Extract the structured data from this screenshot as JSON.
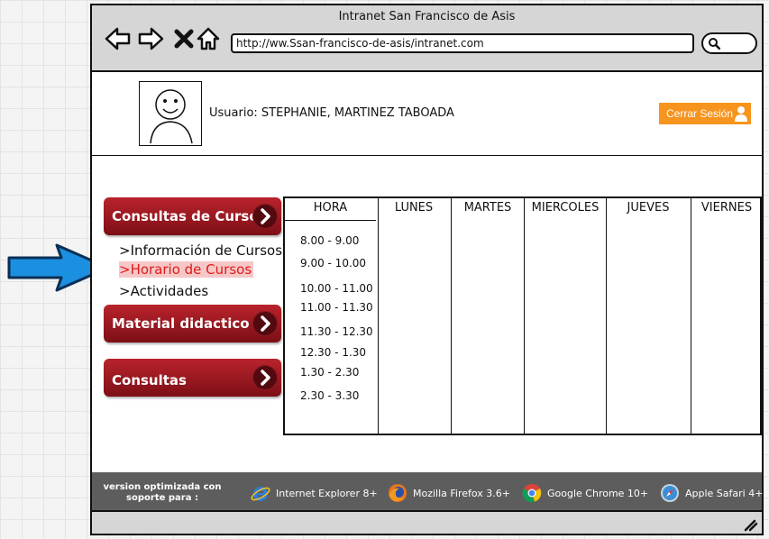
{
  "browser": {
    "window_title": "Intranet San Francisco de Asis",
    "url": "http://ww.Ssan-francisco-de-asis/intranet.com"
  },
  "header": {
    "user_label": "Usuario: STEPHANIE, MARTINEZ TABOADA",
    "logout_label": "Cerrar Sesión"
  },
  "sidebar": {
    "menu": [
      {
        "label": "Consultas de Cursos"
      },
      {
        "label": "Material didactico"
      },
      {
        "label": "Consultas"
      }
    ],
    "submenu": [
      {
        "label": ">Información de Cursos",
        "active": false
      },
      {
        "label": ">Horario de Cursos",
        "active": true
      },
      {
        "label": ">Actividades",
        "active": false
      }
    ]
  },
  "schedule": {
    "columns": [
      "HORA",
      "LUNES",
      "MARTES",
      "MIERCOLES",
      "JUEVES",
      "VIERNES"
    ],
    "hours": [
      "8.00 - 9.00",
      "9.00 - 10.00",
      "10.00 - 11.00",
      "11.00 - 11.30",
      "11.30 - 12.30",
      "12.30 - 1.30",
      "1.30 - 2.30",
      "2.30 - 3.30"
    ]
  },
  "footer": {
    "support_note": "version optimizada con soporte para :",
    "browsers": [
      {
        "name": "Internet Explorer 8+",
        "icon": "internet-explorer-icon"
      },
      {
        "name": "Mozilla Firefox 3.6+",
        "icon": "firefox-icon"
      },
      {
        "name": "Google Chrome 10+",
        "icon": "chrome-icon"
      },
      {
        "name": "Apple Safari 4+",
        "icon": "safari-icon"
      }
    ]
  },
  "colors": {
    "menu_red": "#9b1820",
    "logout_orange": "#f7941d",
    "active_link": "#e01a1a",
    "arrow_blue": "#1b8fe0"
  }
}
